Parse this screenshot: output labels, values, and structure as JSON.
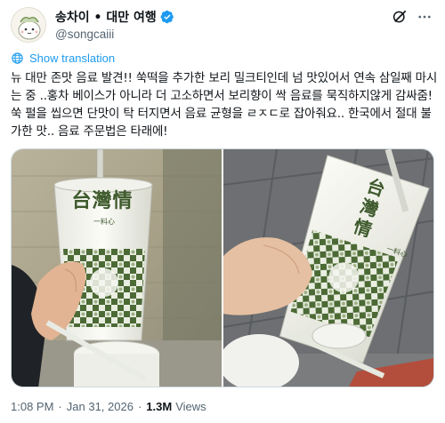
{
  "user": {
    "display_name": "송차이 • 대만 여행",
    "handle": "@songcaiii",
    "verified": true,
    "avatar_icon": "avatar-illustration"
  },
  "header_actions": {
    "grok_icon": "grok-icon",
    "more_icon": "more-icon"
  },
  "translate_label": "Show translation",
  "tweet_lines": [
    "뉴 대만 존맛 음료 발견!! 쑥떡을 추가한 보리 밀크티인데 넘 맛있어서 연속 삼일째 마시",
    "는 중 ..홍차 베이스가 아니라 더 고소하면서 보리향이 싹 음료를 묵직하지않게 감싸줌!",
    "쑥 펄을 씹으면 단맛이 탁 터지면서 음료 균형을 ㄹㅈㄷ로 잡아줘요.. 한국에서 절대 불",
    "가한 맛.. 음료 주문법은 타래에!"
  ],
  "media": {
    "photos": [
      {
        "cup_text": "台灣情",
        "sub_text": "一料心"
      },
      {
        "cup_text": "台灣情",
        "sub_text": "一料心"
      }
    ]
  },
  "meta": {
    "time": "1:08 PM",
    "date": "Jan 31, 2026",
    "views_count": "1.3M",
    "views_label": "Views"
  },
  "colors": {
    "link": "#1d9bf0",
    "secondary_text": "#536471",
    "primary_text": "#0f1419",
    "cup_green": "#3e5a2c"
  }
}
